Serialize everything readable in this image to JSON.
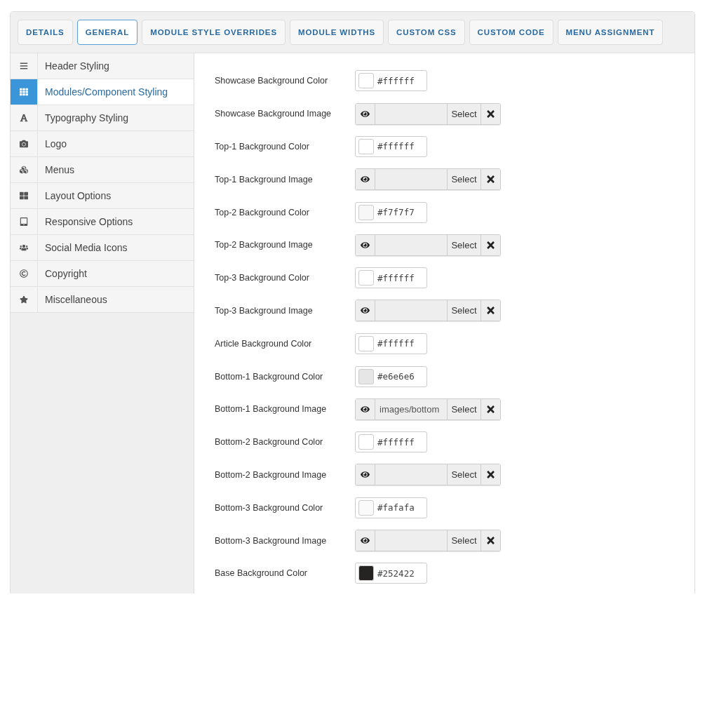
{
  "tabs": [
    {
      "label": "DETAILS",
      "selected": false
    },
    {
      "label": "GENERAL",
      "selected": true
    },
    {
      "label": "MODULE STYLE OVERRIDES",
      "selected": false
    },
    {
      "label": "MODULE WIDTHS",
      "selected": false
    },
    {
      "label": "CUSTOM CSS",
      "selected": false
    },
    {
      "label": "CUSTOM CODE",
      "selected": false
    },
    {
      "label": "MENU ASSIGNMENT",
      "selected": false
    }
  ],
  "sidebar": {
    "items": [
      {
        "label": "Header Styling",
        "selected": false
      },
      {
        "label": "Modules/Component Styling",
        "selected": true
      },
      {
        "label": "Typography Styling",
        "selected": false
      },
      {
        "label": "Logo",
        "selected": false
      },
      {
        "label": "Menus",
        "selected": false
      },
      {
        "label": "Layout Options",
        "selected": false
      },
      {
        "label": "Responsive Options",
        "selected": false
      },
      {
        "label": "Social Media Icons",
        "selected": false
      },
      {
        "label": "Copyright",
        "selected": false
      },
      {
        "label": "Miscellaneous",
        "selected": false
      }
    ]
  },
  "fields": [
    {
      "kind": "color",
      "label": "Showcase Background Color",
      "value": "#ffffff",
      "color": "#ffffff"
    },
    {
      "kind": "image",
      "label": "Showcase Background Image",
      "button": "Select"
    },
    {
      "kind": "color",
      "label": "Top-1 Background Color",
      "value": "#ffffff",
      "color": "#ffffff"
    },
    {
      "kind": "image",
      "label": "Top-1 Background Image",
      "button": "Select"
    },
    {
      "kind": "color",
      "label": "Top-2 Background Color",
      "value": "#f7f7f7",
      "color": "#f7f7f7"
    },
    {
      "kind": "image",
      "label": "Top-2 Background Image",
      "button": "Select"
    },
    {
      "kind": "color",
      "label": "Top-3 Background Color",
      "value": "#ffffff",
      "color": "#ffffff"
    },
    {
      "kind": "image",
      "label": "Top-3 Background Image",
      "button": "Select"
    },
    {
      "kind": "color",
      "label": "Article Background Color",
      "value": "#ffffff",
      "color": "#ffffff"
    },
    {
      "kind": "color",
      "label": "Bottom-1 Background Color",
      "value": "#e6e6e6",
      "color": "#e6e6e6"
    },
    {
      "kind": "image",
      "label": "Bottom-1 Background Image",
      "value": "images/bottom",
      "button": "Select"
    },
    {
      "kind": "color",
      "label": "Bottom-2 Background Color",
      "value": "#ffffff",
      "color": "#ffffff"
    },
    {
      "kind": "image",
      "label": "Bottom-2 Background Image",
      "button": "Select"
    },
    {
      "kind": "color",
      "label": "Bottom-3 Background Color",
      "value": "#fafafa",
      "color": "#fafafa"
    },
    {
      "kind": "image",
      "label": "Bottom-3 Background Image",
      "button": "Select"
    },
    {
      "kind": "color",
      "label": "Base Background Color",
      "value": "#252422",
      "color": "#252422"
    }
  ]
}
